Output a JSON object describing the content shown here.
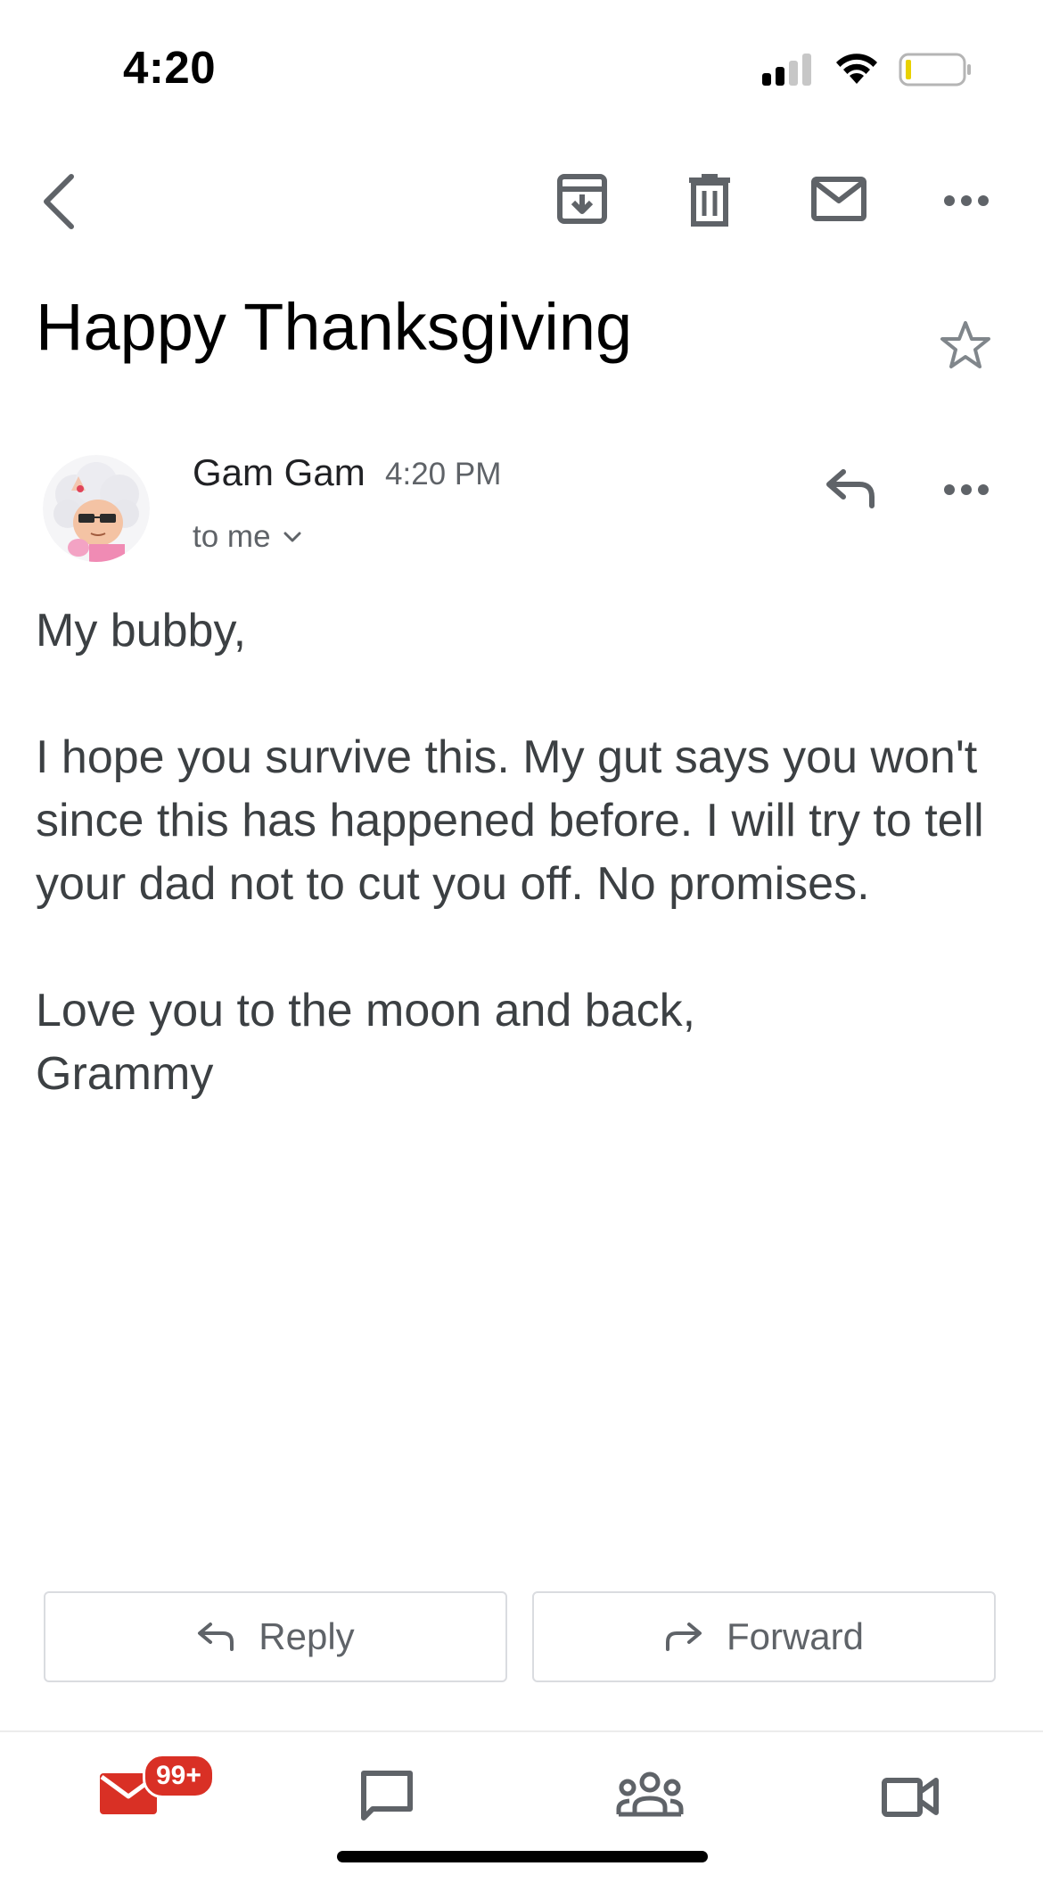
{
  "status_bar": {
    "time": "4:20",
    "battery_color": "#e8d100"
  },
  "toolbar": {
    "back_icon": "chevron-left-icon",
    "archive_icon": "archive-icon",
    "delete_icon": "trash-icon",
    "mark_unread_icon": "envelope-icon",
    "more_icon": "more-horizontal-icon"
  },
  "email": {
    "subject": "Happy Thanksgiving",
    "sender_name": "Gam Gam",
    "time": "4:20 PM",
    "recipient_label": "to me",
    "body": {
      "greeting": "My bubby,",
      "paragraph": "I hope you survive this. My gut says you won't since this has happened before. I will try to tell your dad not to cut you off. No promises.",
      "closing": "Love you to the moon and back,",
      "signature": "Grammy"
    }
  },
  "actions": {
    "reply_label": "Reply",
    "forward_label": "Forward"
  },
  "bottom_nav": {
    "mail_badge": "99+",
    "accent_color": "#d93025"
  }
}
